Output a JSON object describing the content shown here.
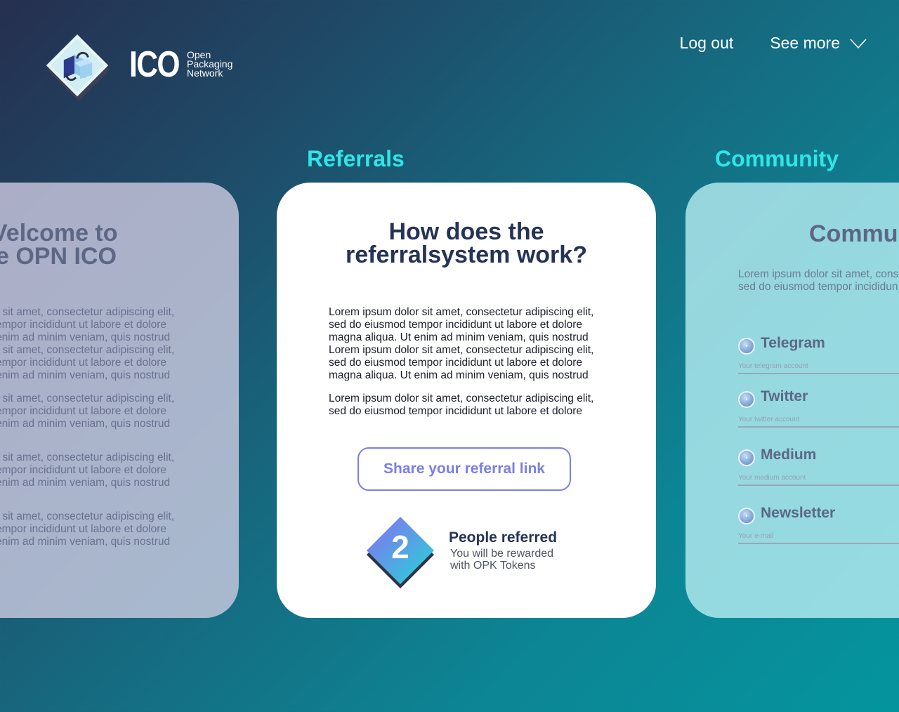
{
  "header": {
    "logo": {
      "name": "ICO",
      "subtitle_lines": [
        "Open",
        "Packaging",
        "Network"
      ]
    },
    "nav": {
      "logout_label": "Log out",
      "see_more_label": "See more",
      "see_more_icon": "chevron-down-icon"
    }
  },
  "sections": {
    "referrals_title": "Referrals",
    "community_title": "Community"
  },
  "welcome_card": {
    "heading_lines": [
      "Velcome to",
      "e OPN ICO"
    ],
    "paragraphs": [
      [
        "r sit amet, consectetur adipiscing elit,",
        "empor incididunt ut labore et dolore",
        "enim ad minim veniam, quis nostrud",
        "r sit amet, consectetur adipiscing elit,",
        "empor incididunt ut labore et dolore",
        "enim ad minim veniam, quis nostrud"
      ],
      [
        "r sit amet, consectetur adipiscing elit,",
        "empor incididunt ut labore et dolore",
        "enim ad minim veniam, quis nostrud"
      ],
      [
        "r sit amet, consectetur adipiscing elit,",
        "empor incididunt ut labore et dolore",
        "enim ad minim veniam, quis nostrud"
      ],
      [
        "r sit amet, consectetur adipiscing elit,",
        "empor incididunt ut labore et dolore",
        "enim ad minim veniam, quis nostrud"
      ]
    ]
  },
  "referral_card": {
    "heading_lines": [
      "How does the",
      "referralsystem work?"
    ],
    "paragraphs": [
      [
        "Lorem ipsum dolor sit amet, consectetur adipiscing elit,",
        "sed do eiusmod tempor incididunt ut labore et dolore",
        "magna aliqua. Ut enim ad minim veniam, quis nostrud",
        "Lorem ipsum dolor sit amet, consectetur adipiscing elit,",
        "sed do eiusmod tempor incididunt ut labore et dolore",
        "magna aliqua. Ut enim ad minim veniam, quis nostrud"
      ],
      [
        "Lorem ipsum dolor sit amet, consectetur adipiscing elit,",
        "sed do eiusmod tempor incididunt ut labore et dolore"
      ]
    ],
    "share_button_label": "Share your referral link",
    "referred_count": "2",
    "referred_title": "People referred",
    "referred_sub_lines": [
      "You will be rewarded",
      "with OPK Tokens"
    ]
  },
  "community_card": {
    "heading": "Commu",
    "intro_lines": [
      "Lorem ipsum dolor sit amet, cons",
      "sed do eiusmod tempor incididun"
    ],
    "items": [
      {
        "label": "Telegram",
        "placeholder": "Your telegram account",
        "icon": "coin-icon"
      },
      {
        "label": "Twitter",
        "placeholder": "Your twitter account",
        "icon": "coin-icon"
      },
      {
        "label": "Medium",
        "placeholder": "Your medium account",
        "icon": "coin-icon"
      },
      {
        "label": "Newsletter",
        "placeholder": "Your e-mail",
        "icon": "coin-icon"
      }
    ]
  },
  "colors": {
    "accent_cyan": "#2ee6e6",
    "button_purple": "#7b7ee8",
    "navy_text": "#253356"
  }
}
